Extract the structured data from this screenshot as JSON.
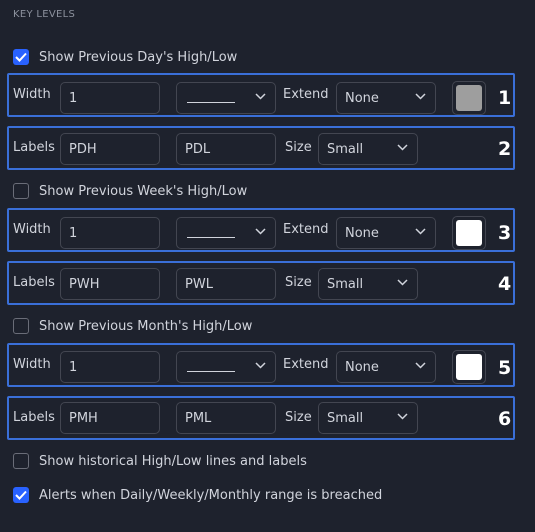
{
  "section_title": "KEY LEVELS",
  "checkboxes": {
    "show_pdhl": {
      "label": "Show Previous Day's High/Low",
      "checked": true
    },
    "show_pwhl": {
      "label": "Show Previous Week's High/Low",
      "checked": false
    },
    "show_pmhl": {
      "label": "Show Previous Month's High/Low",
      "checked": false
    },
    "show_hist": {
      "label": "Show historical High/Low lines and labels",
      "checked": false
    },
    "alerts": {
      "label": "Alerts when Daily/Weekly/Monthly range is breached",
      "checked": true
    }
  },
  "rows": [
    {
      "number": "1",
      "width_label": "Width",
      "width_value": "1",
      "extend_label": "Extend",
      "extend_value": "None",
      "color": "#9e9e9e"
    },
    {
      "number": "2",
      "labels_label": "Labels",
      "high": "PDH",
      "low": "PDL",
      "size_label": "Size",
      "size_value": "Small"
    },
    {
      "number": "3",
      "width_label": "Width",
      "width_value": "1",
      "extend_label": "Extend",
      "extend_value": "None",
      "color": "#ffffff"
    },
    {
      "number": "4",
      "labels_label": "Labels",
      "high": "PWH",
      "low": "PWL",
      "size_label": "Size",
      "size_value": "Small"
    },
    {
      "number": "5",
      "width_label": "Width",
      "width_value": "1",
      "extend_label": "Extend",
      "extend_value": "None",
      "color": "#ffffff"
    },
    {
      "number": "6",
      "labels_label": "Labels",
      "high": "PMH",
      "low": "PML",
      "size_label": "Size",
      "size_value": "Small"
    }
  ],
  "icons": {
    "checkmark": "checkmark-icon",
    "dropdown": "chevron-down-icon"
  },
  "colors": {
    "accent": "#2962ff",
    "highlight_border": "#3a6fd8",
    "background": "#1e222d"
  }
}
